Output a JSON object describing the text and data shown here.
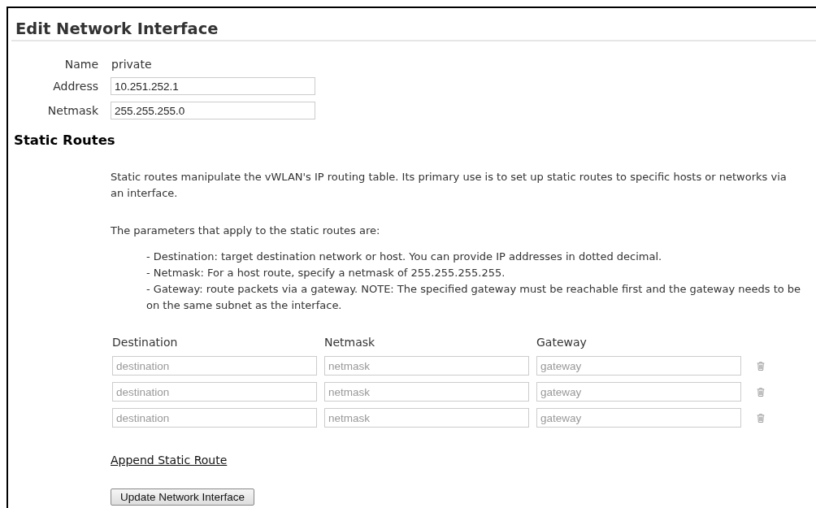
{
  "title": "Edit Network Interface",
  "fields": [
    {
      "kind": "text",
      "label": "Name",
      "value": "private"
    },
    {
      "kind": "input",
      "label": "Address",
      "value": "10.251.252.1"
    },
    {
      "kind": "input",
      "label": "Netmask",
      "value": "255.255.255.0"
    }
  ],
  "static_routes": {
    "heading": "Static Routes",
    "intro": "Static routes manipulate the vWLAN's IP routing table. Its primary use is to set up static routes to specific hosts or networks via an interface.",
    "params_intro": "The parameters that apply to the static routes are:",
    "params": [
      "- Destination: target destination network or host. You can provide IP addresses in dotted decimal.",
      "- Netmask: For a host route, specify a netmask of 255.255.255.255.",
      "- Gateway: route packets via a gateway. NOTE: The specified gateway must be reachable first and the gateway needs to be on the same subnet as the interface."
    ],
    "columns": [
      "Destination",
      "Netmask",
      "Gateway"
    ],
    "rows": [
      {
        "placeholders": [
          "destination",
          "netmask",
          "gateway"
        ]
      },
      {
        "placeholders": [
          "destination",
          "netmask",
          "gateway"
        ]
      },
      {
        "placeholders": [
          "destination",
          "netmask",
          "gateway"
        ]
      }
    ],
    "append_link": "Append Static Route"
  },
  "submit_button": "Update Network Interface"
}
